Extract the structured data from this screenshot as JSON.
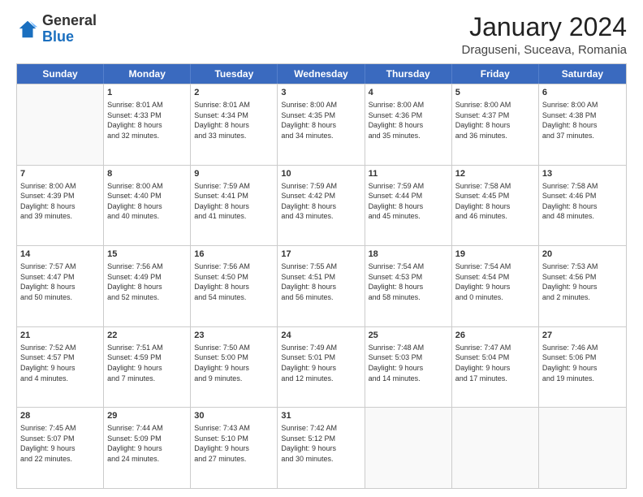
{
  "header": {
    "logo": {
      "general": "General",
      "blue": "Blue"
    },
    "title": "January 2024",
    "subtitle": "Draguseni, Suceava, Romania"
  },
  "weekdays": [
    "Sunday",
    "Monday",
    "Tuesday",
    "Wednesday",
    "Thursday",
    "Friday",
    "Saturday"
  ],
  "weeks": [
    [
      {
        "day": "",
        "empty": true
      },
      {
        "day": "1",
        "sunrise": "8:01 AM",
        "sunset": "4:33 PM",
        "daylight": "8 hours and 32 minutes."
      },
      {
        "day": "2",
        "sunrise": "8:01 AM",
        "sunset": "4:34 PM",
        "daylight": "8 hours and 33 minutes."
      },
      {
        "day": "3",
        "sunrise": "8:00 AM",
        "sunset": "4:35 PM",
        "daylight": "8 hours and 34 minutes."
      },
      {
        "day": "4",
        "sunrise": "8:00 AM",
        "sunset": "4:36 PM",
        "daylight": "8 hours and 35 minutes."
      },
      {
        "day": "5",
        "sunrise": "8:00 AM",
        "sunset": "4:37 PM",
        "daylight": "8 hours and 36 minutes."
      },
      {
        "day": "6",
        "sunrise": "8:00 AM",
        "sunset": "4:38 PM",
        "daylight": "8 hours and 37 minutes."
      }
    ],
    [
      {
        "day": "7",
        "sunrise": "8:00 AM",
        "sunset": "4:39 PM",
        "daylight": "8 hours and 39 minutes."
      },
      {
        "day": "8",
        "sunrise": "8:00 AM",
        "sunset": "4:40 PM",
        "daylight": "8 hours and 40 minutes."
      },
      {
        "day": "9",
        "sunrise": "7:59 AM",
        "sunset": "4:41 PM",
        "daylight": "8 hours and 41 minutes."
      },
      {
        "day": "10",
        "sunrise": "7:59 AM",
        "sunset": "4:42 PM",
        "daylight": "8 hours and 43 minutes."
      },
      {
        "day": "11",
        "sunrise": "7:59 AM",
        "sunset": "4:44 PM",
        "daylight": "8 hours and 45 minutes."
      },
      {
        "day": "12",
        "sunrise": "7:58 AM",
        "sunset": "4:45 PM",
        "daylight": "8 hours and 46 minutes."
      },
      {
        "day": "13",
        "sunrise": "7:58 AM",
        "sunset": "4:46 PM",
        "daylight": "8 hours and 48 minutes."
      }
    ],
    [
      {
        "day": "14",
        "sunrise": "7:57 AM",
        "sunset": "4:47 PM",
        "daylight": "8 hours and 50 minutes."
      },
      {
        "day": "15",
        "sunrise": "7:56 AM",
        "sunset": "4:49 PM",
        "daylight": "8 hours and 52 minutes."
      },
      {
        "day": "16",
        "sunrise": "7:56 AM",
        "sunset": "4:50 PM",
        "daylight": "8 hours and 54 minutes."
      },
      {
        "day": "17",
        "sunrise": "7:55 AM",
        "sunset": "4:51 PM",
        "daylight": "8 hours and 56 minutes."
      },
      {
        "day": "18",
        "sunrise": "7:54 AM",
        "sunset": "4:53 PM",
        "daylight": "8 hours and 58 minutes."
      },
      {
        "day": "19",
        "sunrise": "7:54 AM",
        "sunset": "4:54 PM",
        "daylight": "9 hours and 0 minutes."
      },
      {
        "day": "20",
        "sunrise": "7:53 AM",
        "sunset": "4:56 PM",
        "daylight": "9 hours and 2 minutes."
      }
    ],
    [
      {
        "day": "21",
        "sunrise": "7:52 AM",
        "sunset": "4:57 PM",
        "daylight": "9 hours and 4 minutes."
      },
      {
        "day": "22",
        "sunrise": "7:51 AM",
        "sunset": "4:59 PM",
        "daylight": "9 hours and 7 minutes."
      },
      {
        "day": "23",
        "sunrise": "7:50 AM",
        "sunset": "5:00 PM",
        "daylight": "9 hours and 9 minutes."
      },
      {
        "day": "24",
        "sunrise": "7:49 AM",
        "sunset": "5:01 PM",
        "daylight": "9 hours and 12 minutes."
      },
      {
        "day": "25",
        "sunrise": "7:48 AM",
        "sunset": "5:03 PM",
        "daylight": "9 hours and 14 minutes."
      },
      {
        "day": "26",
        "sunrise": "7:47 AM",
        "sunset": "5:04 PM",
        "daylight": "9 hours and 17 minutes."
      },
      {
        "day": "27",
        "sunrise": "7:46 AM",
        "sunset": "5:06 PM",
        "daylight": "9 hours and 19 minutes."
      }
    ],
    [
      {
        "day": "28",
        "sunrise": "7:45 AM",
        "sunset": "5:07 PM",
        "daylight": "9 hours and 22 minutes."
      },
      {
        "day": "29",
        "sunrise": "7:44 AM",
        "sunset": "5:09 PM",
        "daylight": "9 hours and 24 minutes."
      },
      {
        "day": "30",
        "sunrise": "7:43 AM",
        "sunset": "5:10 PM",
        "daylight": "9 hours and 27 minutes."
      },
      {
        "day": "31",
        "sunrise": "7:42 AM",
        "sunset": "5:12 PM",
        "daylight": "9 hours and 30 minutes."
      },
      {
        "day": "",
        "empty": true
      },
      {
        "day": "",
        "empty": true
      },
      {
        "day": "",
        "empty": true
      }
    ]
  ]
}
